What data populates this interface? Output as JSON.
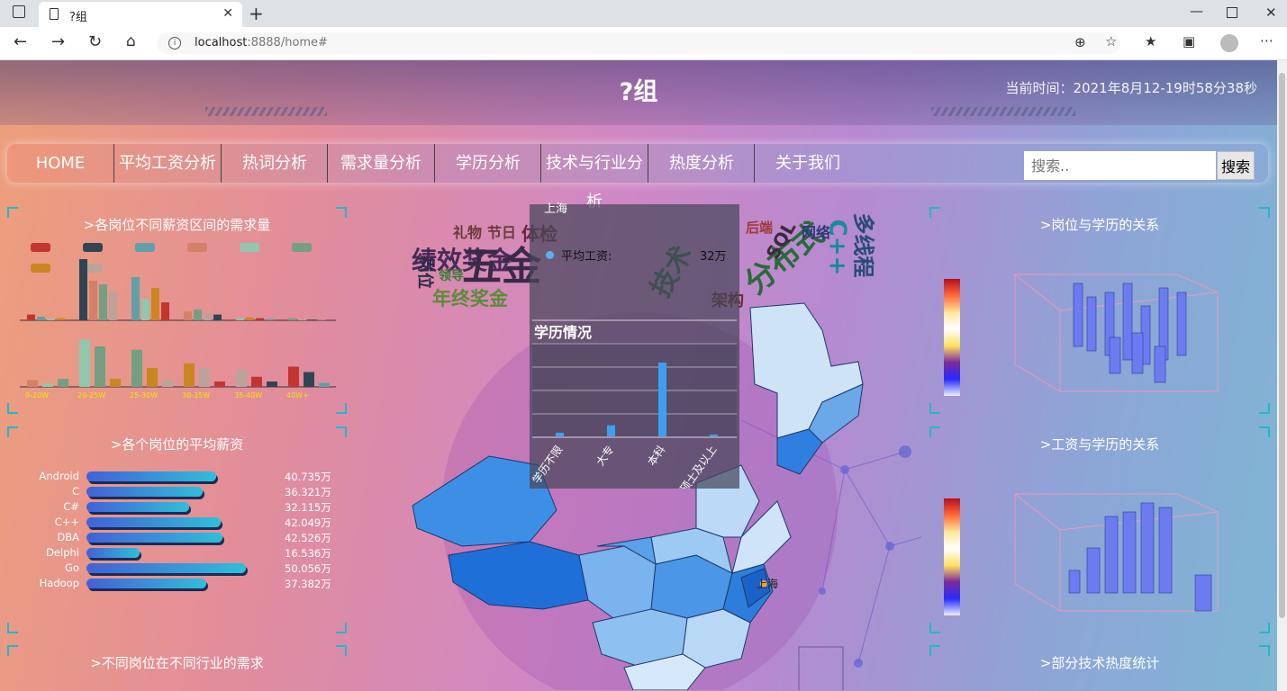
{
  "browser": {
    "tab_title": "?组",
    "url_host": "localhost",
    "url_rest": ":8888/home#"
  },
  "header": {
    "title": "?组",
    "time": "当前时间：2021年8月12-19时58分38秒"
  },
  "nav": [
    "HOME",
    "平均工资分析",
    "热词分析",
    "需求量分析",
    "学历分析",
    "技术与行业分析",
    "热度分析",
    "关于我们"
  ],
  "search": {
    "placeholder": "搜索..",
    "button": "搜索"
  },
  "panels": {
    "left1": ">各岗位不同薪资区间的需求量",
    "left2": ">各个岗位的平均薪资",
    "left3": ">不同岗位在不同行业的需求",
    "right1": ">岗位与学历的关系",
    "right2": ">工资与学历的关系",
    "right3": ">部分技术热度统计"
  },
  "salary_chart": {
    "categories": [
      "0-20W",
      "20-25W",
      "25-30W",
      "30-35W",
      "35-40W",
      "40W+"
    ],
    "colors": [
      "#c23531",
      "#2f4554",
      "#61a0a8",
      "#d48265",
      "#91c7ae",
      "#749f83",
      "#ca8622",
      "#bda29a"
    ],
    "top_values": [
      [
        8,
        85,
        60,
        12,
        3,
        3
      ],
      [
        5,
        55,
        30,
        15,
        4,
        2
      ],
      [
        2,
        50,
        45,
        10,
        3,
        1
      ],
      [
        3,
        40,
        25,
        8,
        2,
        1
      ]
    ],
    "bottom_values": [
      [
        10,
        5,
        12
      ],
      [
        70,
        60,
        12
      ],
      [
        55,
        28,
        10
      ],
      [
        35,
        28,
        8
      ],
      [
        25,
        15,
        8
      ],
      [
        30,
        22,
        6
      ]
    ]
  },
  "avg_salary": {
    "items": [
      {
        "name": "Android",
        "value": 40.735,
        "label": "40.735万"
      },
      {
        "name": "C",
        "value": 36.321,
        "label": "36.321万"
      },
      {
        "name": "C#",
        "value": 32.115,
        "label": "32.115万"
      },
      {
        "name": "C++",
        "value": 42.049,
        "label": "42.049万"
      },
      {
        "name": "DBA",
        "value": 42.526,
        "label": "42.526万"
      },
      {
        "name": "Delphi",
        "value": 16.536,
        "label": "16.536万"
      },
      {
        "name": "Go",
        "value": 50.056,
        "label": "50.056万"
      },
      {
        "name": "Hadoop",
        "value": 37.382,
        "label": "37.382万"
      }
    ]
  },
  "wordcloud": [
    {
      "t": "绩效奖金",
      "c": "#4a2a5a",
      "s": 28
    },
    {
      "t": "年终奖金",
      "c": "#5c8a3a",
      "s": 21
    },
    {
      "t": "五金",
      "c": "#3a2a4a",
      "s": 44
    },
    {
      "t": "礼物",
      "c": "#6a3a3a",
      "s": 16
    },
    {
      "t": "节日",
      "c": "#6a3a3a",
      "s": 16
    },
    {
      "t": "体检",
      "c": "#6a2a3a",
      "s": 20
    },
    {
      "t": "领导",
      "c": "#3a7a3a",
      "s": 14
    },
    {
      "t": "岗位",
      "c": "#2a2a4a",
      "s": 18
    },
    {
      "t": "技术",
      "c": "#2a6a3a",
      "s": 30
    },
    {
      "t": "分布式",
      "c": "#2a6a3a",
      "s": 34
    },
    {
      "t": "后端",
      "c": "#a03a3a",
      "s": 15
    },
    {
      "t": "SQL",
      "c": "#3a2a3a",
      "s": 20
    },
    {
      "t": "网络",
      "c": "#2a3a7a",
      "s": 16
    },
    {
      "t": "C++",
      "c": "#1a8a9a",
      "s": 26
    },
    {
      "t": "多线程",
      "c": "#2a4a7a",
      "s": 24
    },
    {
      "t": "架构",
      "c": "#6a2a2a",
      "s": 18
    }
  ],
  "popup": {
    "province": "上海",
    "label": "平均工资:",
    "value": "32万",
    "chart_title": "学历情况",
    "education": [
      "学历不限",
      "大专",
      "本科",
      "硕士及以上"
    ],
    "edu_values": [
      2,
      6,
      40,
      1
    ]
  },
  "map_city": "上海",
  "chart_data": [
    {
      "type": "bar",
      "title": ">各个岗位的平均薪资",
      "categories": [
        "Android",
        "C",
        "C#",
        "C++",
        "DBA",
        "Delphi",
        "Go",
        "Hadoop"
      ],
      "values": [
        40.735,
        36.321,
        32.115,
        42.049,
        42.526,
        16.536,
        50.056,
        37.382
      ],
      "unit": "万"
    },
    {
      "type": "bar",
      "title": "学历情况",
      "categories": [
        "学历不限",
        "大专",
        "本科",
        "硕士及以上"
      ],
      "values": [
        2,
        6,
        40,
        1
      ]
    }
  ]
}
